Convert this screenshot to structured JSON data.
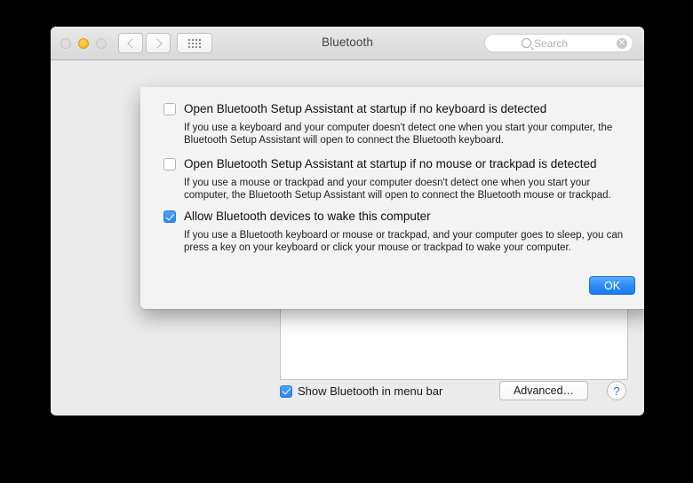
{
  "window": {
    "title": "Bluetooth",
    "traffic_lights": [
      {
        "name": "close",
        "state": "disabled"
      },
      {
        "name": "minimize",
        "state": "active"
      },
      {
        "name": "zoom",
        "state": "disabled"
      }
    ],
    "toolbar": {
      "back_icon": "chevron-left-icon",
      "forward_icon": "chevron-right-icon",
      "show_all_icon": "grid-dots-icon"
    },
    "search": {
      "placeholder": "Search",
      "value": "",
      "icon": "search-icon",
      "clear_icon": "clear-icon",
      "clear_glyph": "✕"
    }
  },
  "sheet": {
    "options": [
      {
        "label": "Open Bluetooth Setup Assistant at startup if no keyboard is detected",
        "checked": false,
        "description": "If you use a keyboard and your computer doesn't detect one when you start your computer, the Bluetooth Setup Assistant will open to connect the Bluetooth keyboard."
      },
      {
        "label": "Open Bluetooth Setup Assistant at startup if no mouse or trackpad is detected",
        "checked": false,
        "description": "If you use a mouse or trackpad and your computer doesn't detect one when you start your computer, the Bluetooth Setup Assistant will open to connect the Bluetooth mouse or trackpad."
      },
      {
        "label": "Allow Bluetooth devices to wake this computer",
        "checked": true,
        "description": "If you use a Bluetooth keyboard or mouse or trackpad, and your computer goes to sleep, you can press a key on your keyboard or click your mouse or trackpad to wake your computer."
      }
    ],
    "ok_label": "OK"
  },
  "bottom_bar": {
    "menu_bar_checkbox": {
      "label": "Show Bluetooth in menu bar",
      "checked": true
    },
    "advanced_label": "Advanced…",
    "help_label": "?"
  },
  "colors": {
    "accent_blue": "#2d8df6",
    "checkbox_blue": "#3b8ff0",
    "window_bg": "#ebebeb",
    "sheet_bg": "#f3f3f3",
    "titlebar_bg": "#e0e0e0",
    "backdrop": "#000000"
  }
}
